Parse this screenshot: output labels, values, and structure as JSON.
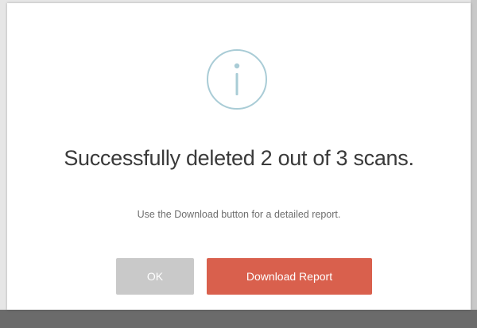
{
  "dialog": {
    "icon": "info-icon",
    "title": "Successfully deleted 2 out of 3 scans.",
    "message": "Use the Download button for a detailed report.",
    "buttons": {
      "ok_label": "OK",
      "download_label": "Download Report"
    }
  },
  "colors": {
    "accent": "#d9604d",
    "disabled": "#c9c9c9",
    "icon": "#a9ccd6",
    "title_text": "#3a3a3a"
  }
}
